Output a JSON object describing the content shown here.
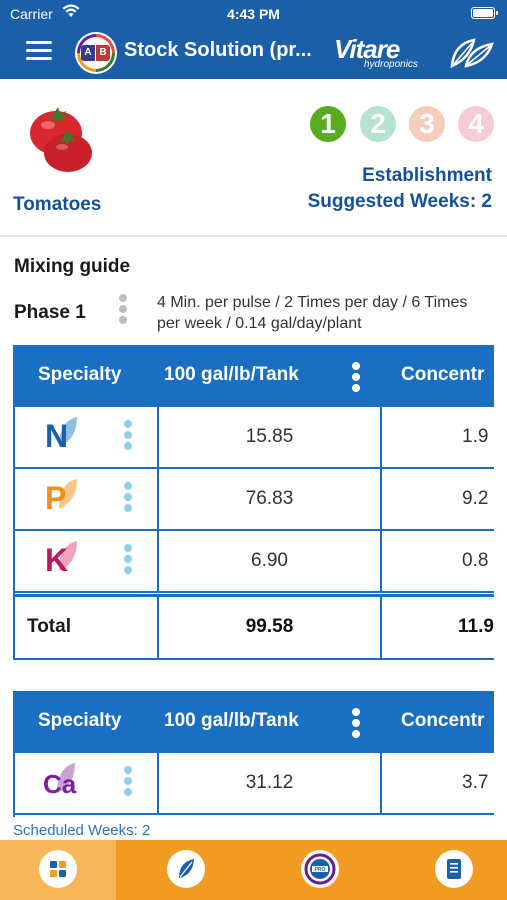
{
  "status_bar": {
    "carrier": "Carrier",
    "time": "4:43 PM"
  },
  "nav": {
    "title": "Stock Solution (pr...",
    "brand_name": "Vitare",
    "brand_sub": "hydroponics",
    "logo_a": "A",
    "logo_b": "B"
  },
  "crop": {
    "name": "Tomatoes",
    "phases": [
      {
        "label": "1",
        "color": "#5aac1e",
        "active": true
      },
      {
        "label": "2",
        "color": "#b6e3cf",
        "active": false
      },
      {
        "label": "3",
        "color": "#f6cdbb",
        "active": false
      },
      {
        "label": "4",
        "color": "#f6cdd3",
        "active": false
      }
    ],
    "stage": "Establishment",
    "suggested_weeks": "Suggested Weeks: 2"
  },
  "mixing": {
    "title": "Mixing guide",
    "phase_label": "Phase 1",
    "phase_desc": "4 Min. per pulse / 2 Times per day / 6 Times per week / 0.14 gal/day/plant"
  },
  "table1": {
    "headers": [
      "Specialty",
      "100 gal/lb/Tank",
      "Concentr"
    ],
    "rows": [
      {
        "nutrient": "N",
        "color": "#1b5fa8",
        "leaf": "#8fbfe6",
        "value1": "15.85",
        "value2": "1.9"
      },
      {
        "nutrient": "P",
        "color": "#f28c1c",
        "leaf": "#f9c58a",
        "value1": "76.83",
        "value2": "9.2"
      },
      {
        "nutrient": "K",
        "color": "#c2185b",
        "leaf": "#f0a3bd",
        "value1": "6.90",
        "value2": "0.8"
      }
    ],
    "total": {
      "label": "Total",
      "value1": "99.58",
      "value2": "11.9"
    }
  },
  "table2": {
    "headers": [
      "Specialty",
      "100 gal/lb/Tank",
      "Concentr"
    ],
    "rows": [
      {
        "nutrient": "Ca",
        "color": "#7b1fa2",
        "leaf": "#c9a3d6",
        "value1": "31.12",
        "value2": "3.7"
      }
    ]
  },
  "scheduled_weeks": "Scheduled Weeks: 2",
  "tabs": [
    {
      "icon": "dashboard-icon",
      "active": true
    },
    {
      "icon": "leaf-icon",
      "active": false
    },
    {
      "icon": "pro-icon",
      "active": false
    },
    {
      "icon": "checklist-icon",
      "active": false
    }
  ]
}
